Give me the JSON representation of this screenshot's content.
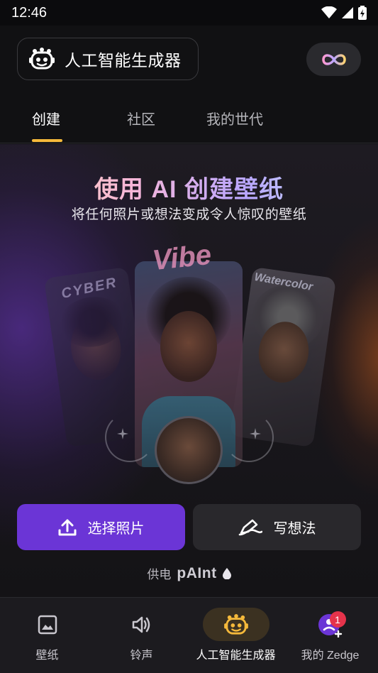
{
  "status_bar": {
    "time": "12:46"
  },
  "header": {
    "title": "人工智能生成器",
    "icons": {
      "title": "robot-face-icon",
      "right": "infinity-icon"
    }
  },
  "tabs": [
    {
      "label": "创建",
      "active": true
    },
    {
      "label": "社区",
      "active": false
    },
    {
      "label": "我的世代",
      "active": false
    }
  ],
  "hero": {
    "title": "使用 AI 创建壁纸",
    "subtitle": "将任何照片或想法变成令人惊叹的壁纸",
    "card_words": {
      "left": "CYBER",
      "center": "Vibe",
      "right": "Watercolor"
    }
  },
  "actions": {
    "primary": {
      "label": "选择照片",
      "icon": "upload-icon"
    },
    "secondary": {
      "label": "写想法",
      "icon": "pen-icon"
    }
  },
  "powered_by": {
    "prefix": "供电",
    "brand": "pAInt",
    "icon": "drop-icon"
  },
  "bottom_nav": [
    {
      "label": "壁纸",
      "icon": "image-icon",
      "active": false
    },
    {
      "label": "铃声",
      "icon": "speaker-icon",
      "active": false
    },
    {
      "label": "人工智能生成器",
      "icon": "robot-face-icon",
      "active": true
    },
    {
      "label": "我的 Zedge",
      "icon": "profile-icon",
      "active": false,
      "badge": "1"
    }
  ],
  "colors": {
    "accent": "#6b35d6",
    "tab_indicator": "#f5b93b",
    "badge": "#e5334b",
    "nav_active_pill": "#3b3121"
  }
}
